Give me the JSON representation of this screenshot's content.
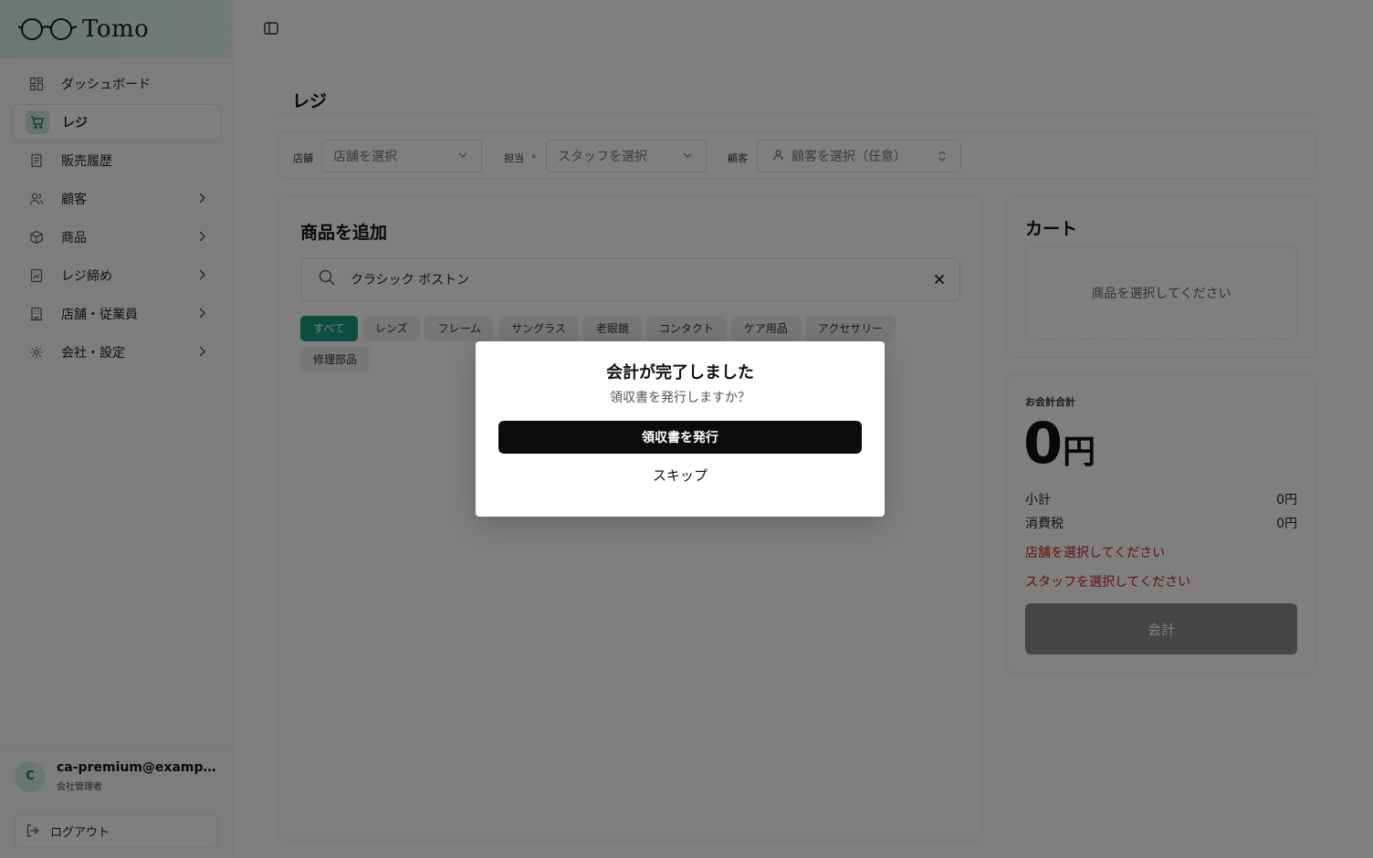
{
  "app": {
    "brand": "Tomo"
  },
  "sidebar": {
    "items": [
      {
        "label": "ダッシュボード",
        "icon": "dashboard-icon"
      },
      {
        "label": "レジ",
        "icon": "cart-icon",
        "active": true
      },
      {
        "label": "販売履歴",
        "icon": "receipt-icon"
      },
      {
        "label": "顧客",
        "icon": "users-icon",
        "has_children": true
      },
      {
        "label": "商品",
        "icon": "box-icon",
        "has_children": true
      },
      {
        "label": "レジ締め",
        "icon": "register-close-icon",
        "has_children": true
      },
      {
        "label": "店舗・従業員",
        "icon": "store-icon",
        "has_children": true
      },
      {
        "label": "会社・設定",
        "icon": "gear-icon",
        "has_children": true
      }
    ],
    "user": {
      "avatar_initial": "C",
      "email": "ca-premium@example.com",
      "role": "会社管理者"
    },
    "logout_label": "ログアウト"
  },
  "page": {
    "title": "レジ"
  },
  "filters": {
    "store_label": "店舗",
    "store_placeholder": "店舗を選択",
    "staff_label": "担当",
    "staff_required_mark": "*",
    "staff_placeholder": "スタッフを選択",
    "customer_label": "顧客",
    "customer_placeholder": "顧客を選択（任意）"
  },
  "product_panel": {
    "title": "商品を追加",
    "search_value": "クラシック ボストン",
    "categories": [
      "すべて",
      "レンズ",
      "フレーム",
      "サングラス",
      "老眼鏡",
      "コンタクト",
      "ケア用品",
      "アクセサリー",
      "修理部品"
    ],
    "active_category": "すべて"
  },
  "cart": {
    "title": "カート",
    "empty_message": "商品を選択してください"
  },
  "summary": {
    "total_label": "お会計合計",
    "total_amount": "0",
    "total_unit": "円",
    "subtotal_label": "小計",
    "subtotal_value": "0円",
    "tax_label": "消費税",
    "tax_value": "0円",
    "warning_store": "店舗を選択してください",
    "warning_staff": "スタッフを選択してください",
    "checkout_label": "会計"
  },
  "modal": {
    "title": "会計が完了しました",
    "subtitle": "領収書を発行しますか？",
    "primary_label": "領収書を発行",
    "skip_label": "スキップ"
  },
  "colors": {
    "accent": "#1a9d82",
    "warning": "#c61f1f",
    "primary_button": "#0b0b0b"
  }
}
